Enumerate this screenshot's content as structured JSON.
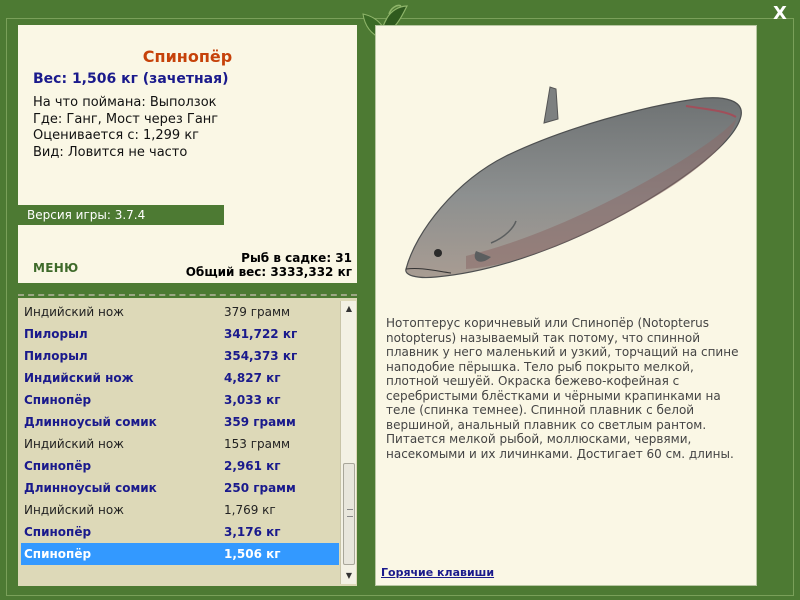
{
  "window": {
    "close_label": "X"
  },
  "fish": {
    "name": "Спинопёр",
    "weight_line": "Вес: 1,506 кг (зачетная)",
    "caught_on": "На что поймана: Выползок",
    "location": "Где: Ганг, Мост через Ганг",
    "valued_from": "Оценивается с: 1,299 кг",
    "rarity": "Вид: Ловится не часто",
    "description": "Нотоптерус коричневый или Спинопёр (Notopterus notopterus) называемый так потому, что спинной плавник у него маленький и узкий, торчащий на спине наподобие пёрышка. Тело рыб покрыто мелкой, плотной чешуёй. Окраска бежево-кофейная с серебристыми блёстками и чёрными крапинками на теле (спинка темнее). Спинной плавник с белой вершиной, анальный плавник со светлым рантом. Питается мелкой рыбой, моллюсками, червями, насекомыми и их личинками. Достигает 60 см. длины."
  },
  "game": {
    "version": "Версия игры: 3.7.4"
  },
  "menu": {
    "label": "МЕНЮ"
  },
  "keep": {
    "count_line": "Рыб в садке: 31",
    "total_weight_line": "Общий вес: 3333,332 кг"
  },
  "catch_list": [
    {
      "name": "Индийский нож",
      "weight": "379 грамм",
      "trophy": false,
      "selected": false
    },
    {
      "name": "Пилорыл",
      "weight": "341,722 кг",
      "trophy": true,
      "selected": false
    },
    {
      "name": "Пилорыл",
      "weight": "354,373 кг",
      "trophy": true,
      "selected": false
    },
    {
      "name": "Индийский нож",
      "weight": "4,827 кг",
      "trophy": true,
      "selected": false
    },
    {
      "name": "Спинопёр",
      "weight": "3,033 кг",
      "trophy": true,
      "selected": false
    },
    {
      "name": "Длинноусый сомик",
      "weight": "359 грамм",
      "trophy": true,
      "selected": false
    },
    {
      "name": "Индийский нож",
      "weight": "153 грамм",
      "trophy": false,
      "selected": false
    },
    {
      "name": "Спинопёр",
      "weight": "2,961 кг",
      "trophy": true,
      "selected": false
    },
    {
      "name": "Длинноусый сомик",
      "weight": "250 грамм",
      "trophy": true,
      "selected": false
    },
    {
      "name": "Индийский нож",
      "weight": "1,769 кг",
      "trophy": false,
      "selected": false
    },
    {
      "name": "Спинопёр",
      "weight": "3,176 кг",
      "trophy": true,
      "selected": false
    },
    {
      "name": "Спинопёр",
      "weight": "1,506 кг",
      "trophy": true,
      "selected": true
    }
  ],
  "scrollbar": {
    "up_icon": "arrow-up-icon",
    "down_icon": "arrow-down-icon"
  },
  "links": {
    "hotkeys": "Горячие клавиши"
  },
  "colors": {
    "frame": "#4d7a33",
    "panel": "#faf7e5",
    "list_bg": "#ddd9b8",
    "fish_name": "#c6420a",
    "trophy_text": "#1a1a8c",
    "selection": "#3399ff"
  }
}
